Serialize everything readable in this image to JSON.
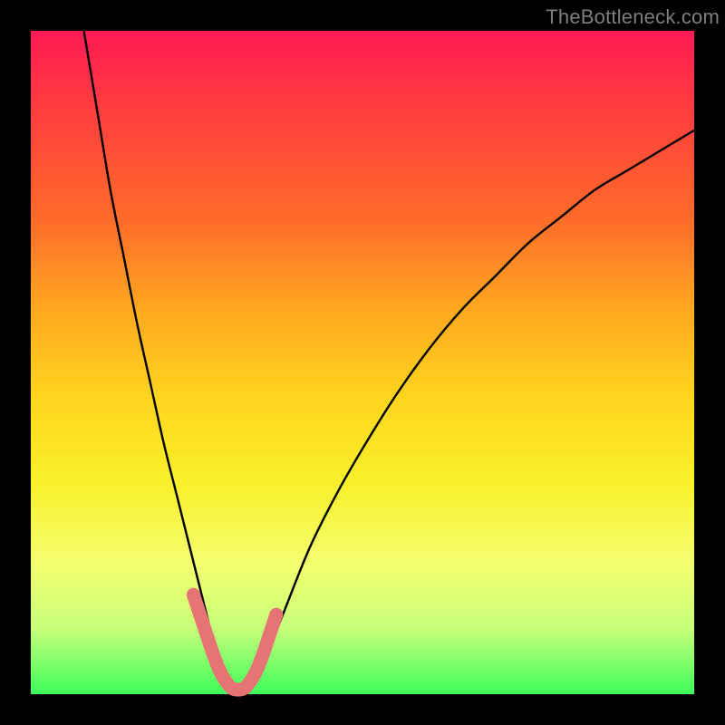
{
  "watermark": "TheBottleneck.com",
  "chart_data": {
    "type": "line",
    "title": "",
    "xlabel": "",
    "ylabel": "",
    "xlim": [
      0,
      100
    ],
    "ylim": [
      0,
      100
    ],
    "series": [
      {
        "name": "curve",
        "x": [
          8,
          10,
          12,
          14,
          16,
          18,
          20,
          22,
          24,
          25,
          26,
          27,
          28,
          29,
          30,
          31,
          32,
          33,
          34,
          36,
          38,
          42,
          46,
          50,
          55,
          60,
          65,
          70,
          75,
          80,
          85,
          90,
          95,
          100
        ],
        "values": [
          100,
          88,
          76,
          66,
          56,
          47,
          38,
          30,
          22,
          18,
          14,
          10,
          6,
          3,
          1,
          0,
          0,
          1,
          3,
          7,
          12,
          22,
          30,
          37,
          45,
          52,
          58,
          63,
          68,
          72,
          76,
          79,
          82,
          85
        ]
      },
      {
        "name": "marker",
        "x": [
          24.5,
          25.5,
          26.5,
          27.5,
          28.5,
          29.5,
          30.5,
          32.0,
          33.0,
          34.0,
          35.0,
          36.0,
          37.0
        ],
        "values": [
          15.0,
          12.0,
          9.0,
          6.0,
          3.5,
          1.8,
          0.8,
          0.8,
          1.8,
          3.5,
          6.0,
          9.0,
          12.0
        ]
      }
    ],
    "colors": {
      "curve": "#000000",
      "marker": "#e77474"
    }
  }
}
